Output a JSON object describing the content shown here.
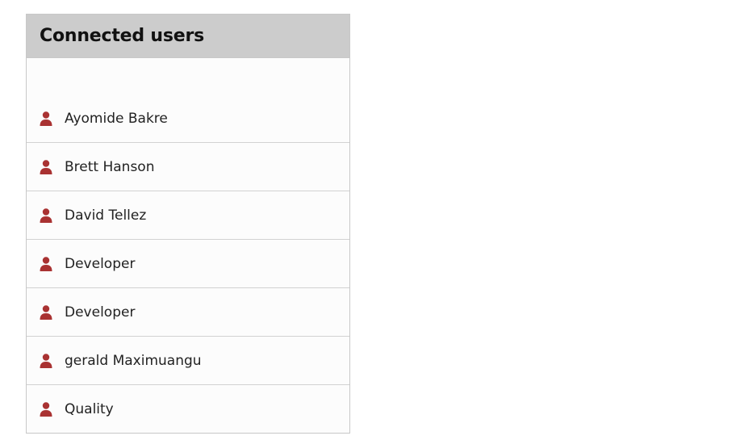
{
  "panel": {
    "title": "Connected users",
    "icon": "user-icon",
    "icon_color": "#a93232",
    "header_bg": "#cccccc"
  },
  "users": [
    {
      "name": "Ayomide Bakre"
    },
    {
      "name": "Brett Hanson"
    },
    {
      "name": "David Tellez"
    },
    {
      "name": "Developer"
    },
    {
      "name": "Developer"
    },
    {
      "name": "gerald Maximuangu"
    },
    {
      "name": "Quality"
    }
  ]
}
